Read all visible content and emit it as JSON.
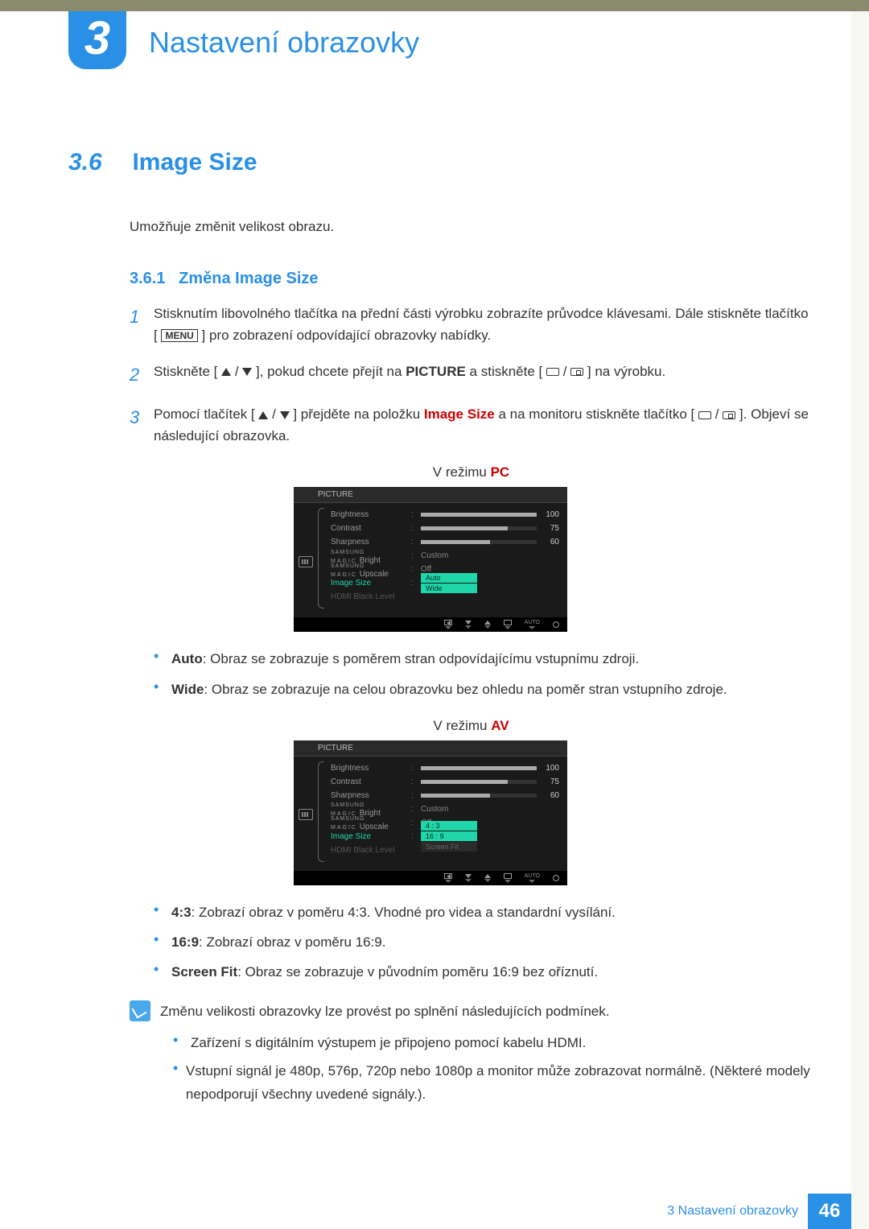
{
  "chapter": {
    "number": "3",
    "title": "Nastavení obrazovky"
  },
  "section": {
    "number": "3.6",
    "title": "Image Size"
  },
  "intro": "Umožňuje změnit velikost obrazu.",
  "subsection": {
    "number": "3.6.1",
    "title": "Změna Image Size"
  },
  "steps": {
    "s1": "Stisknutím libovolného tlačítka na přední části výrobku zobrazíte průvodce klávesami. Dále stiskněte tlačítko [",
    "s1b": "] pro zobrazení odpovídající obrazovky nabídky.",
    "menu": "MENU",
    "s2a": "Stiskněte [",
    "s2b": "], pokud chcete přejít na ",
    "s2c": " a stiskněte [",
    "s2d": "] na výrobku.",
    "picture": "PICTURE",
    "s3a": "Pomocí tlačítek [",
    "s3b": "] přejděte na položku ",
    "s3c": " a na monitoru stiskněte tlačítko [",
    "s3d": "]. Objeví se následující obrazovka.",
    "imgsize": "Image Size"
  },
  "mode_pc": {
    "prefix": "V režimu ",
    "mode": "PC"
  },
  "mode_av": {
    "prefix": "V režimu ",
    "mode": "AV"
  },
  "osd": {
    "header": "PICTURE",
    "rows": {
      "brightness": "Brightness",
      "contrast": "Contrast",
      "sharpness": "Sharpness",
      "magic_bright_sub": "Bright",
      "magic_upscale_sub": "Upscale",
      "magic_brand_s": "SAMSUNG",
      "magic_brand_m": "MAGIC",
      "image_size": "Image Size",
      "hdmi_black": "HDMI Black Level"
    },
    "vals": {
      "brightness": "100",
      "contrast": "75",
      "sharpness": "60",
      "custom": "Custom",
      "off": "Off"
    },
    "pc_opts": {
      "a": "Auto",
      "b": "Wide"
    },
    "av_opts": {
      "a": "4 : 3",
      "b": "16 : 9",
      "c": "Screen Fit"
    },
    "footer_auto": "AUTO"
  },
  "pc_bullets": {
    "auto_l": "Auto",
    "auto_t": ": Obraz se zobrazuje s poměrem stran odpovídajícímu vstupnímu zdroji.",
    "wide_l": "Wide",
    "wide_t": ": Obraz se zobrazuje na celou obrazovku bez ohledu na poměr stran vstupního zdroje."
  },
  "av_bullets": {
    "b43_l": "4:3",
    "b43_t": ": Zobrazí obraz v poměru 4:3. Vhodné pro videa a standardní vysílání.",
    "b169_l": "16:9",
    "b169_t": ": Zobrazí obraz v poměru 16:9.",
    "sf_l": "Screen Fit",
    "sf_t": ": Obraz se zobrazuje v původním poměru 16:9 bez oříznutí."
  },
  "note": {
    "lead": "Změnu velikosti obrazovky lze provést po splnění následujících podmínek.",
    "n1": "Zařízení s digitálním výstupem je připojeno pomocí kabelu HDMI.",
    "n2": "Vstupní signál je 480p, 576p, 720p nebo 1080p a monitor může zobrazovat normálně. (Některé modely nepodporují všechny uvedené signály.)."
  },
  "footer": {
    "text": "3 Nastavení obrazovky",
    "page": "46"
  }
}
